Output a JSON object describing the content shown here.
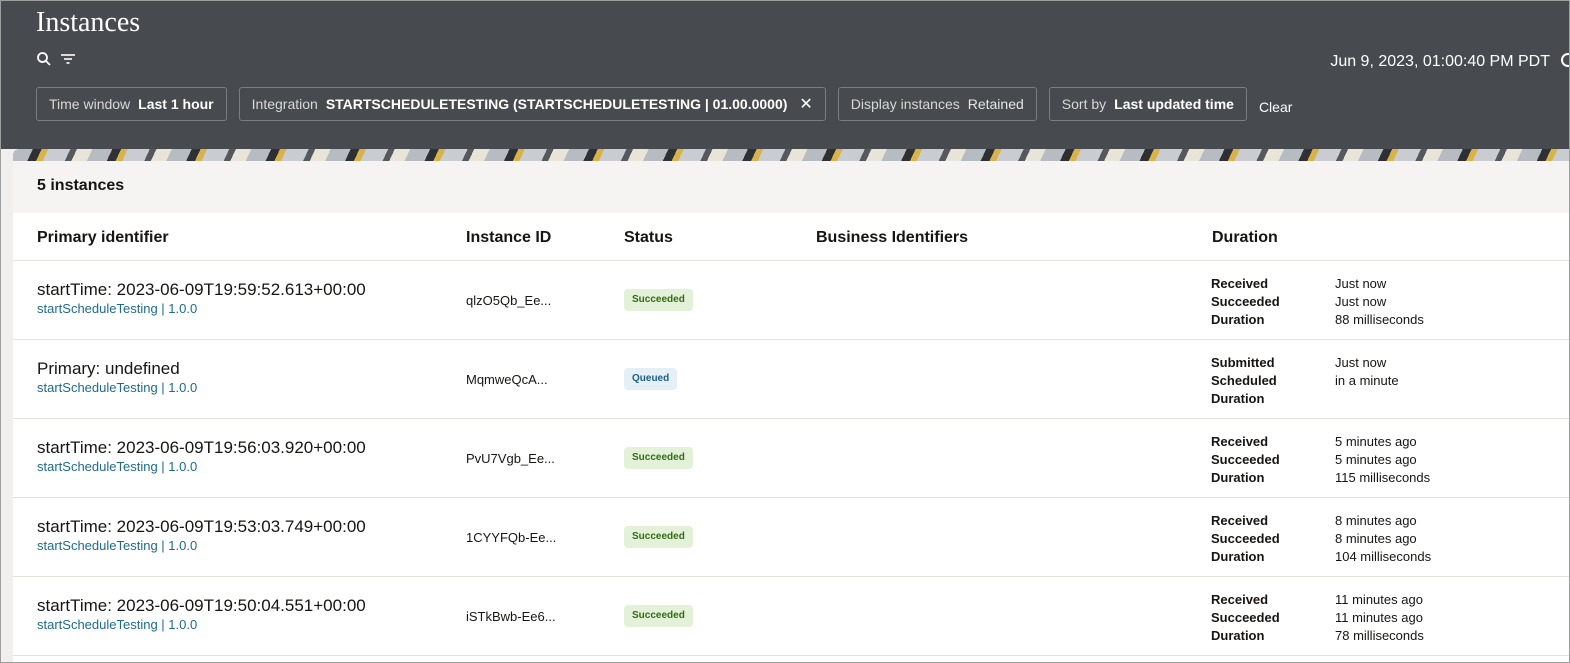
{
  "header": {
    "title": "Instances",
    "timestamp": "Jun 9, 2023, 01:00:40 PM PDT",
    "filters": [
      {
        "label": "Time window",
        "value": "Last 1 hour",
        "removable": false
      },
      {
        "label": "Integration",
        "value": "STARTSCHEDULETESTING (STARTSCHEDULETESTING | 01.00.0000)",
        "removable": true
      },
      {
        "label": "Display instances",
        "value": "Retained",
        "removable": false
      },
      {
        "label": "Sort by",
        "value": "Last updated time",
        "removable": false
      }
    ],
    "clear_label": "Clear",
    "icons": [
      "search-icon",
      "filter-icon",
      "refresh-icon"
    ]
  },
  "summary": {
    "count_label": "5 instances"
  },
  "table": {
    "columns": [
      "Primary identifier",
      "Instance ID",
      "Status",
      "Business Identifiers",
      "Duration"
    ],
    "rows": [
      {
        "primary": "startTime: 2023-06-09T19:59:52.613+00:00",
        "integration": "startScheduleTesting | 1.0.0",
        "instance_id": "qlzO5Qb_Ee...",
        "status": "Succeeded",
        "status_kind": "ok",
        "durations": [
          {
            "k": "Received",
            "v": "Just now"
          },
          {
            "k": "Succeeded",
            "v": "Just now"
          },
          {
            "k": "Duration",
            "v": "88 milliseconds"
          }
        ]
      },
      {
        "primary": "Primary: undefined",
        "integration": "startScheduleTesting | 1.0.0",
        "instance_id": "MqmweQcA...",
        "status": "Queued",
        "status_kind": "queued",
        "durations": [
          {
            "k": "Submitted",
            "v": "Just now"
          },
          {
            "k": "Scheduled",
            "v": "in a minute"
          },
          {
            "k": "Duration",
            "v": ""
          }
        ]
      },
      {
        "primary": "startTime: 2023-06-09T19:56:03.920+00:00",
        "integration": "startScheduleTesting | 1.0.0",
        "instance_id": "PvU7Vgb_Ee...",
        "status": "Succeeded",
        "status_kind": "ok",
        "durations": [
          {
            "k": "Received",
            "v": "5 minutes ago"
          },
          {
            "k": "Succeeded",
            "v": "5 minutes ago"
          },
          {
            "k": "Duration",
            "v": "115 milliseconds"
          }
        ]
      },
      {
        "primary": "startTime: 2023-06-09T19:53:03.749+00:00",
        "integration": "startScheduleTesting | 1.0.0",
        "instance_id": "1CYYFQb-Ee...",
        "status": "Succeeded",
        "status_kind": "ok",
        "durations": [
          {
            "k": "Received",
            "v": "8 minutes ago"
          },
          {
            "k": "Succeeded",
            "v": "8 minutes ago"
          },
          {
            "k": "Duration",
            "v": "104 milliseconds"
          }
        ]
      },
      {
        "primary": "startTime: 2023-06-09T19:50:04.551+00:00",
        "integration": "startScheduleTesting | 1.0.0",
        "instance_id": "iSTkBwb-Ee6...",
        "status": "Succeeded",
        "status_kind": "ok",
        "durations": [
          {
            "k": "Received",
            "v": "11 minutes ago"
          },
          {
            "k": "Succeeded",
            "v": "11 minutes ago"
          },
          {
            "k": "Duration",
            "v": "78 milliseconds"
          }
        ]
      }
    ]
  },
  "colors": {
    "header_bg": "#474a4f",
    "link": "#1d6b8c",
    "success_bg": "#e3f1d8",
    "queued_bg": "#e4eff6"
  }
}
